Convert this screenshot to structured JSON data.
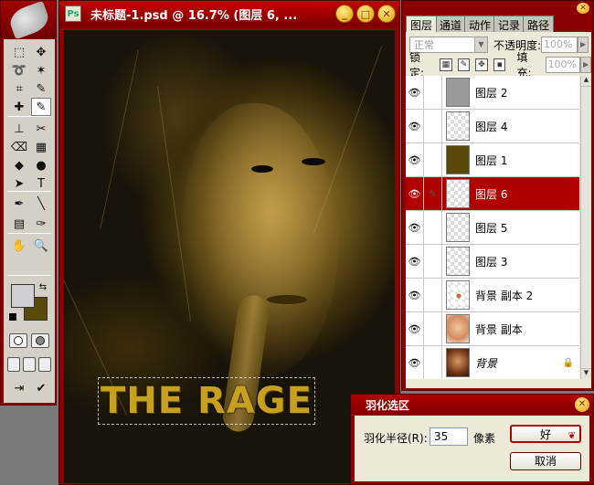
{
  "document": {
    "title": "未标题-1.psd @ 16.7% (图层 6, ...",
    "buttons": {
      "minimize": "_",
      "restore": "□",
      "close": "✕"
    },
    "art_text": "THE RAGE"
  },
  "toolbox": {
    "tools": [
      "marquee-tool",
      "move-tool",
      "lasso-tool",
      "magic-wand-tool",
      "crop-tool",
      "slice-tool",
      "healing-brush-tool",
      "brush-tool",
      "clone-stamp-tool",
      "history-brush-tool",
      "eraser-tool",
      "gradient-tool",
      "blur-tool",
      "dodge-tool",
      "path-selection-tool",
      "type-tool",
      "pen-tool",
      "line-tool",
      "notes-tool",
      "eyedropper-tool",
      "hand-tool",
      "zoom-tool"
    ],
    "glyphs": [
      "⬚",
      "✥",
      "➰",
      "✶",
      "⌗",
      "✎",
      "✚",
      "✎",
      "⊥",
      "✂",
      "⌫",
      "▦",
      "◆",
      "●",
      "➤",
      "T",
      "✒",
      "╲",
      "▤",
      "✑",
      "✋",
      "🔍"
    ],
    "active_index": 7,
    "foreground_color": "#cfcfd4",
    "background_color": "#5a4a0a"
  },
  "layers_panel": {
    "tabs": [
      "图层",
      "通道",
      "动作",
      "记录",
      "路径"
    ],
    "blend_mode": "正常",
    "opacity_label": "不透明度:",
    "opacity_value": "100%",
    "lock_label": "锁定:",
    "fill_label": "填充:",
    "fill_value": "100%",
    "layers": [
      {
        "name": "图层 2",
        "thumb": "gray",
        "selected": false,
        "locked": false
      },
      {
        "name": "图层 4",
        "thumb": "checker",
        "selected": false,
        "locked": false
      },
      {
        "name": "图层 1",
        "thumb": "olive",
        "selected": false,
        "locked": false
      },
      {
        "name": "图层 6",
        "thumb": "checker",
        "selected": true,
        "locked": false
      },
      {
        "name": "图层 5",
        "thumb": "checker",
        "selected": false,
        "locked": false
      },
      {
        "name": "图层 3",
        "thumb": "checker",
        "selected": false,
        "locked": false
      },
      {
        "name": "背景 副本 2",
        "thumb": "checker-dot",
        "selected": false,
        "locked": false
      },
      {
        "name": "背景 副本",
        "thumb": "face-light",
        "selected": false,
        "locked": false
      },
      {
        "name": "背景",
        "thumb": "face",
        "selected": false,
        "locked": true
      }
    ]
  },
  "feather_dialog": {
    "title": "羽化选区",
    "radius_label": "羽化半径(R):",
    "radius_value": "35",
    "unit": "像素",
    "ok_label": "好",
    "cancel_label": "取消"
  },
  "colors": {
    "chrome_red": "#8b0000",
    "selected_layer": "#b00000",
    "panel_bg": "#ece9d8"
  }
}
